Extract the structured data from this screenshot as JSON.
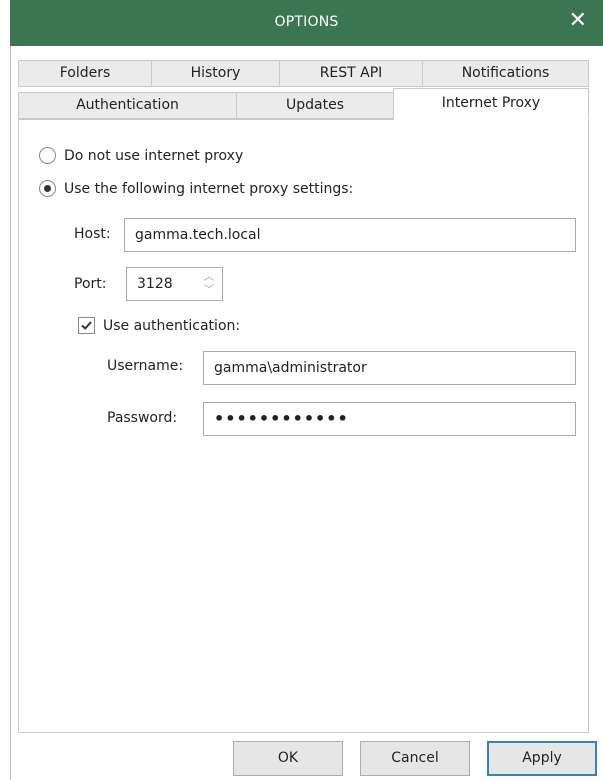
{
  "dialog": {
    "title": "OPTIONS",
    "close_glyph": "✕"
  },
  "tabs": {
    "row1": [
      {
        "label": "Folders"
      },
      {
        "label": "History"
      },
      {
        "label": "REST API"
      },
      {
        "label": "Notifications"
      }
    ],
    "row2": [
      {
        "label": "Authentication"
      },
      {
        "label": "Updates"
      },
      {
        "label": "Internet Proxy"
      }
    ],
    "active": "Internet Proxy"
  },
  "proxy": {
    "option_none": {
      "label": "Do not use internet proxy",
      "selected": false
    },
    "option_custom": {
      "label": "Use the following internet proxy settings:",
      "selected": true
    },
    "host_label": "Host:",
    "host_value": "gamma.tech.local",
    "port_label": "Port:",
    "port_value": "3128",
    "use_auth": {
      "label": "Use authentication:",
      "checked": true
    },
    "username_label": "Username:",
    "username_value": "gamma\\administrator",
    "password_label": "Password:",
    "password_value": "••••••••••••"
  },
  "buttons": {
    "ok": "OK",
    "cancel": "Cancel",
    "apply": "Apply"
  },
  "colors": {
    "titlebar": "#3b7552",
    "accent_border": "#3c7cc4"
  }
}
